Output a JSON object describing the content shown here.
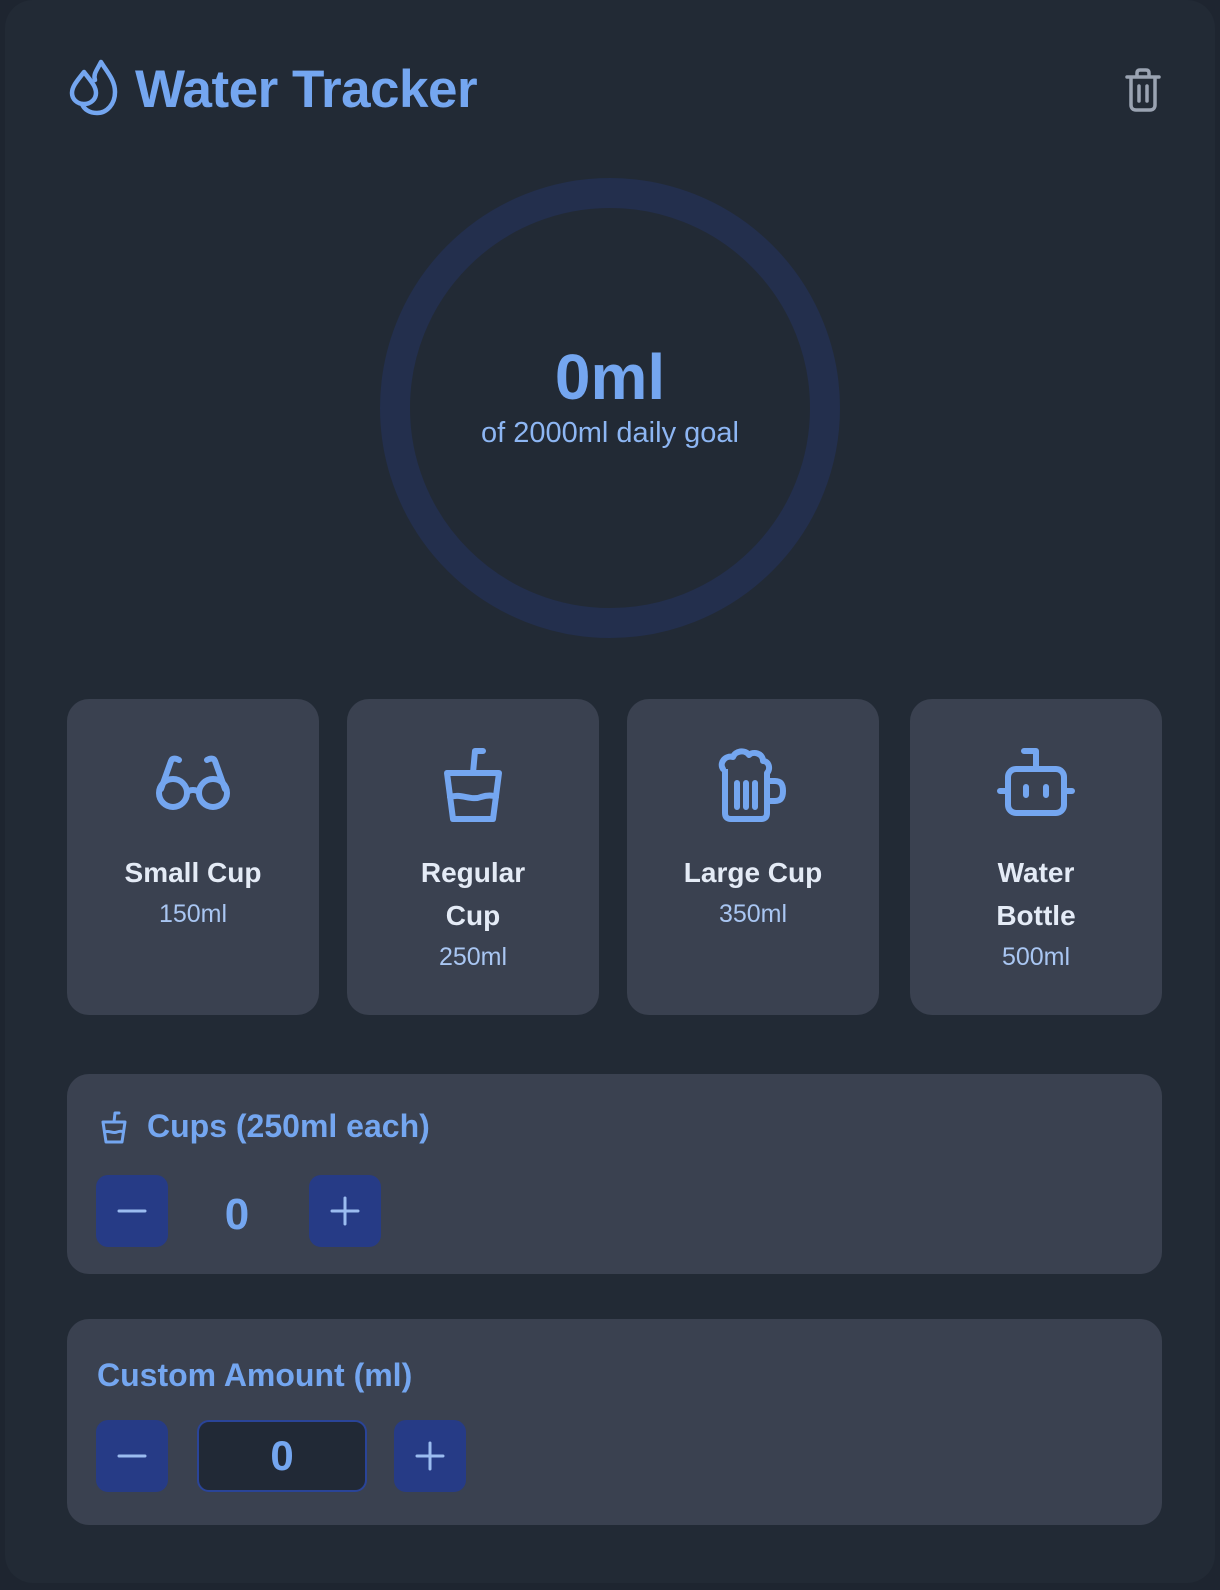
{
  "app": {
    "title": "Water Tracker",
    "accent_color": "#74a6f0",
    "background_color": "#222a35"
  },
  "progress": {
    "current_label": "0ml",
    "goal_label": "of 2000ml daily goal",
    "fraction": 0
  },
  "presets": [
    {
      "icon": "glasses-icon",
      "label": "Small Cup",
      "amount": "150ml"
    },
    {
      "icon": "cup-with-straw-icon",
      "label": "Regular Cup",
      "amount": "250ml"
    },
    {
      "icon": "beer-mug-icon",
      "label": "Large Cup",
      "amount": "350ml"
    },
    {
      "icon": "robot-icon",
      "label": "Water Bottle",
      "amount": "500ml"
    }
  ],
  "cups": {
    "title": "Cups (250ml each)",
    "count": "0",
    "minus_label": "−",
    "plus_label": "+"
  },
  "custom": {
    "title": "Custom Amount (ml)",
    "value": "0"
  }
}
